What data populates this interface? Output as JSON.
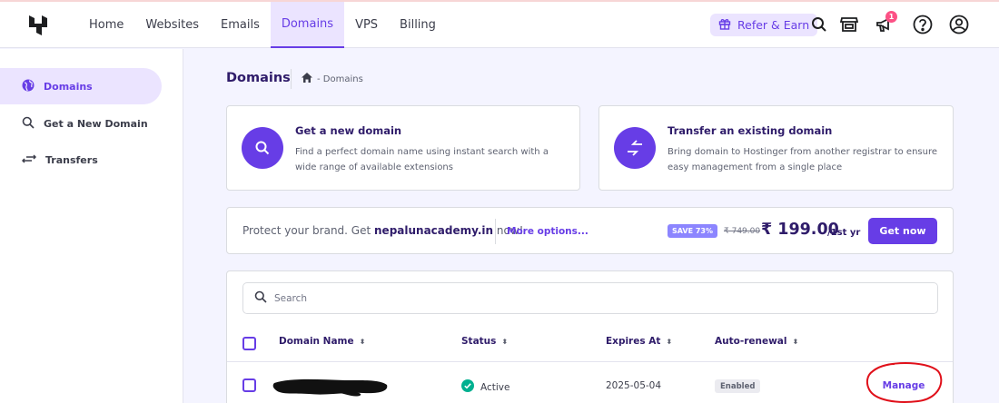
{
  "header": {
    "nav": [
      "Home",
      "Websites",
      "Emails",
      "Domains",
      "VPS",
      "Billing"
    ],
    "active_nav": "Domains",
    "refer_label": "Refer & Earn",
    "notification_count": "1"
  },
  "sidebar": {
    "items": [
      {
        "label": "Domains",
        "icon": "globe-icon",
        "active": true
      },
      {
        "label": "Get a New Domain",
        "icon": "search-icon",
        "active": false
      },
      {
        "label": "Transfers",
        "icon": "transfer-icon",
        "active": false
      }
    ]
  },
  "page": {
    "title": "Domains",
    "breadcrumb": "- Domains"
  },
  "cards": [
    {
      "title": "Get a new domain",
      "desc": "Find a perfect domain name using instant search with a wide range of available extensions",
      "icon": "search-icon"
    },
    {
      "title": "Transfer an existing domain",
      "desc": "Bring domain to Hostinger from another registrar to ensure easy management from a single place",
      "icon": "transfer-arrows-icon"
    }
  ],
  "promo": {
    "text_before": "Protect your brand. Get",
    "domain": "nepalunacademy.in",
    "text_after": "now!",
    "more_label": "More options...",
    "save_badge": "SAVE 73%",
    "old_price": "₹ 749.00",
    "price": "₹ 199.00",
    "per": "/1st yr",
    "cta": "Get now"
  },
  "table": {
    "search_placeholder": "Search",
    "columns": [
      "Domain Name",
      "Status",
      "Expires At",
      "Auto-renewal"
    ],
    "rows": [
      {
        "status": "Active",
        "expires": "2025-05-04",
        "auto_renewal": "Enabled",
        "action": "Manage"
      }
    ]
  },
  "colors": {
    "primary": "#673de6",
    "primary_light": "#ebe4ff",
    "success": "#00b090",
    "dark": "#2f1c6a"
  }
}
